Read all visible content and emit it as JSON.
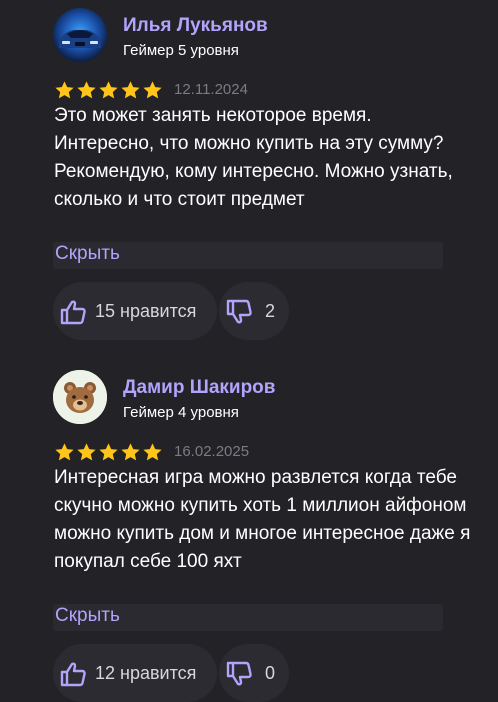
{
  "reviews": [
    {
      "name": "Илья Лукьянов",
      "level": "Геймер 5 уровня",
      "rating": 5,
      "date": "12.11.2024",
      "text": "Это может занять некоторое время. Интересно, что можно купить на эту сумму? Рекомендую, кому интересно. Можно узнать, сколько и что стоит предмет",
      "hide_label": "Скрыть",
      "likes_label": "15 нравится",
      "dislikes_label": "2",
      "avatar_icon": "car-avatar-icon"
    },
    {
      "name": "Дамир Шакиров",
      "level": "Геймер 4 уровня",
      "rating": 5,
      "date": "16.02.2025",
      "text": "Интересная игра можно развлется когда тебе скучно можно купить хоть 1 миллион айфоном можно купить дом и многое интересное даже я покупал себе 100 яхт",
      "hide_label": "Скрыть",
      "likes_label": "12 нравится",
      "dislikes_label": "0",
      "avatar_icon": "bear-avatar-icon"
    }
  ],
  "colors": {
    "background": "#232227",
    "accent": "#b0a4fb",
    "star": "#ffc51a",
    "date": "#7d7b82",
    "button_bg": "#2c2b31"
  }
}
